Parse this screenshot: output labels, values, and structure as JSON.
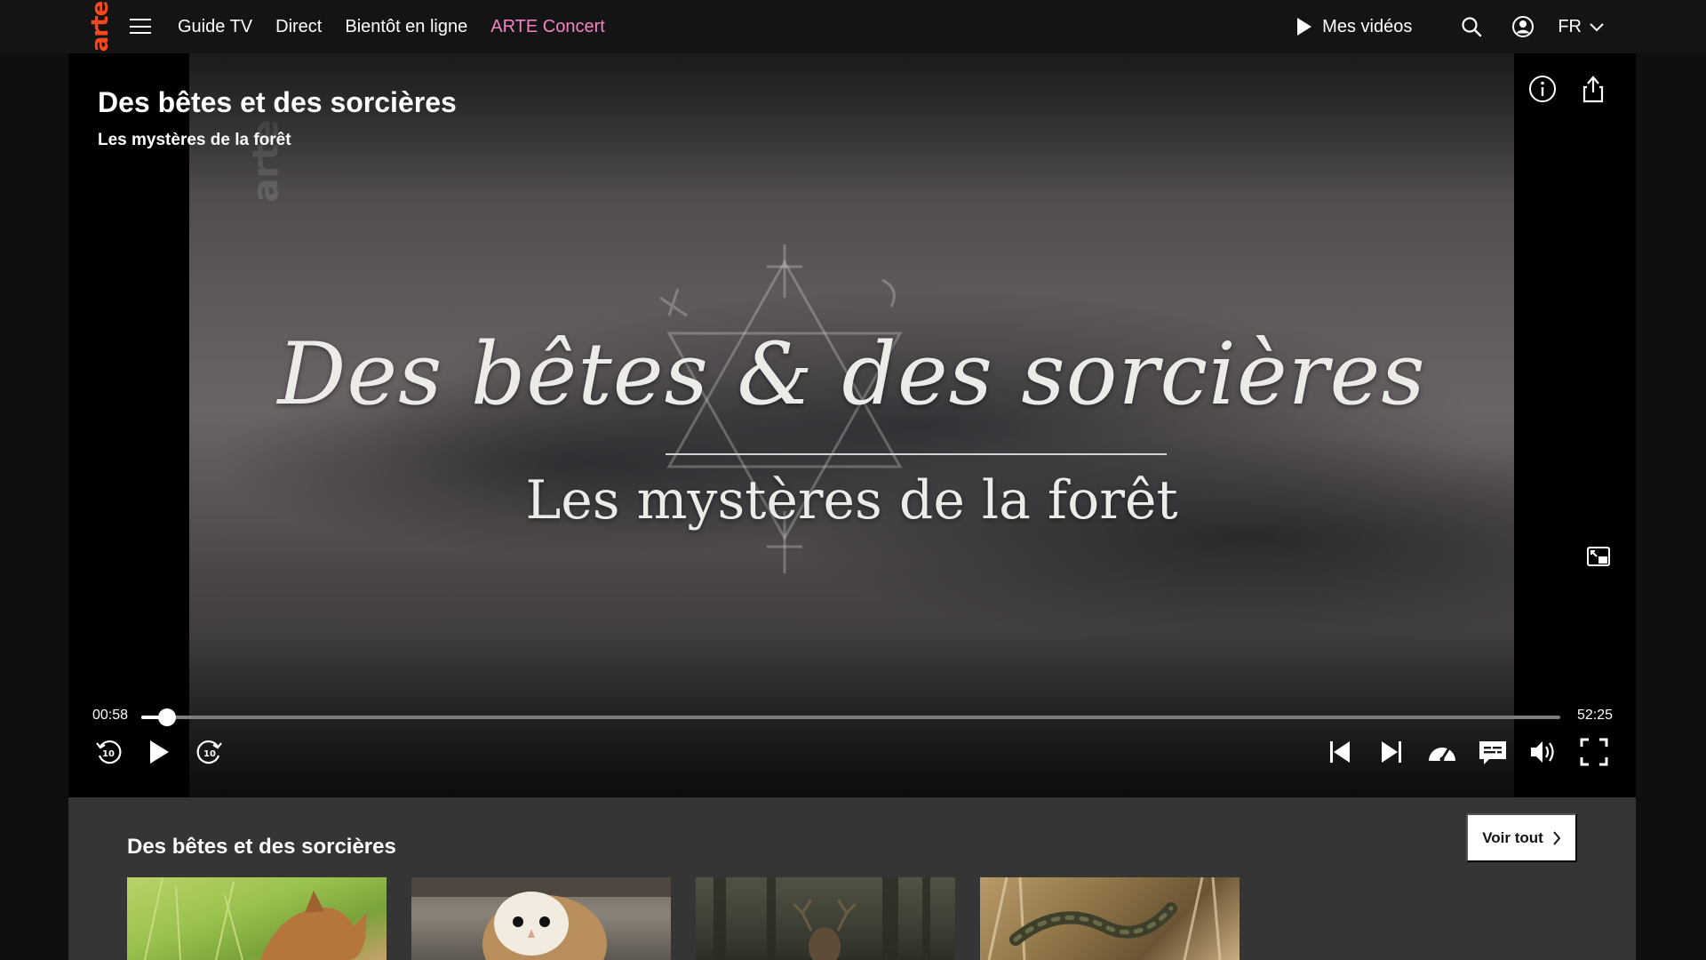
{
  "nav": {
    "logo": "arte",
    "links": [
      "Guide TV",
      "Direct",
      "Bientôt en ligne",
      "ARTE Concert"
    ],
    "mes_videos": "Mes vidéos",
    "language": "FR",
    "accent_color": "#f582c4",
    "logo_color": "#fa481c"
  },
  "player": {
    "title": "Des bêtes et des sorcières",
    "subtitle": "Les mystères de la forêt",
    "frame_title": "Des bêtes & des sorcières",
    "frame_subtitle": "Les mystères de la forêt",
    "current_time": "00:58",
    "total_time": "52:25",
    "progress": 0.0184,
    "controls_left": [
      "rewind-10-icon",
      "play-icon",
      "forward-10-icon"
    ],
    "controls_right": [
      "previous-icon",
      "next-icon",
      "speed-icon",
      "subtitles-icon",
      "volume-icon",
      "fullscreen-icon"
    ],
    "top_icons": [
      "info-icon",
      "share-icon"
    ]
  },
  "related": {
    "title": "Des bêtes et des sorcières",
    "see_all": "Voir tout",
    "thumbnails": [
      "fox-kit-thumbnail",
      "barn-owl-thumbnail",
      "deer-forest-thumbnail",
      "grass-snake-thumbnail"
    ]
  }
}
